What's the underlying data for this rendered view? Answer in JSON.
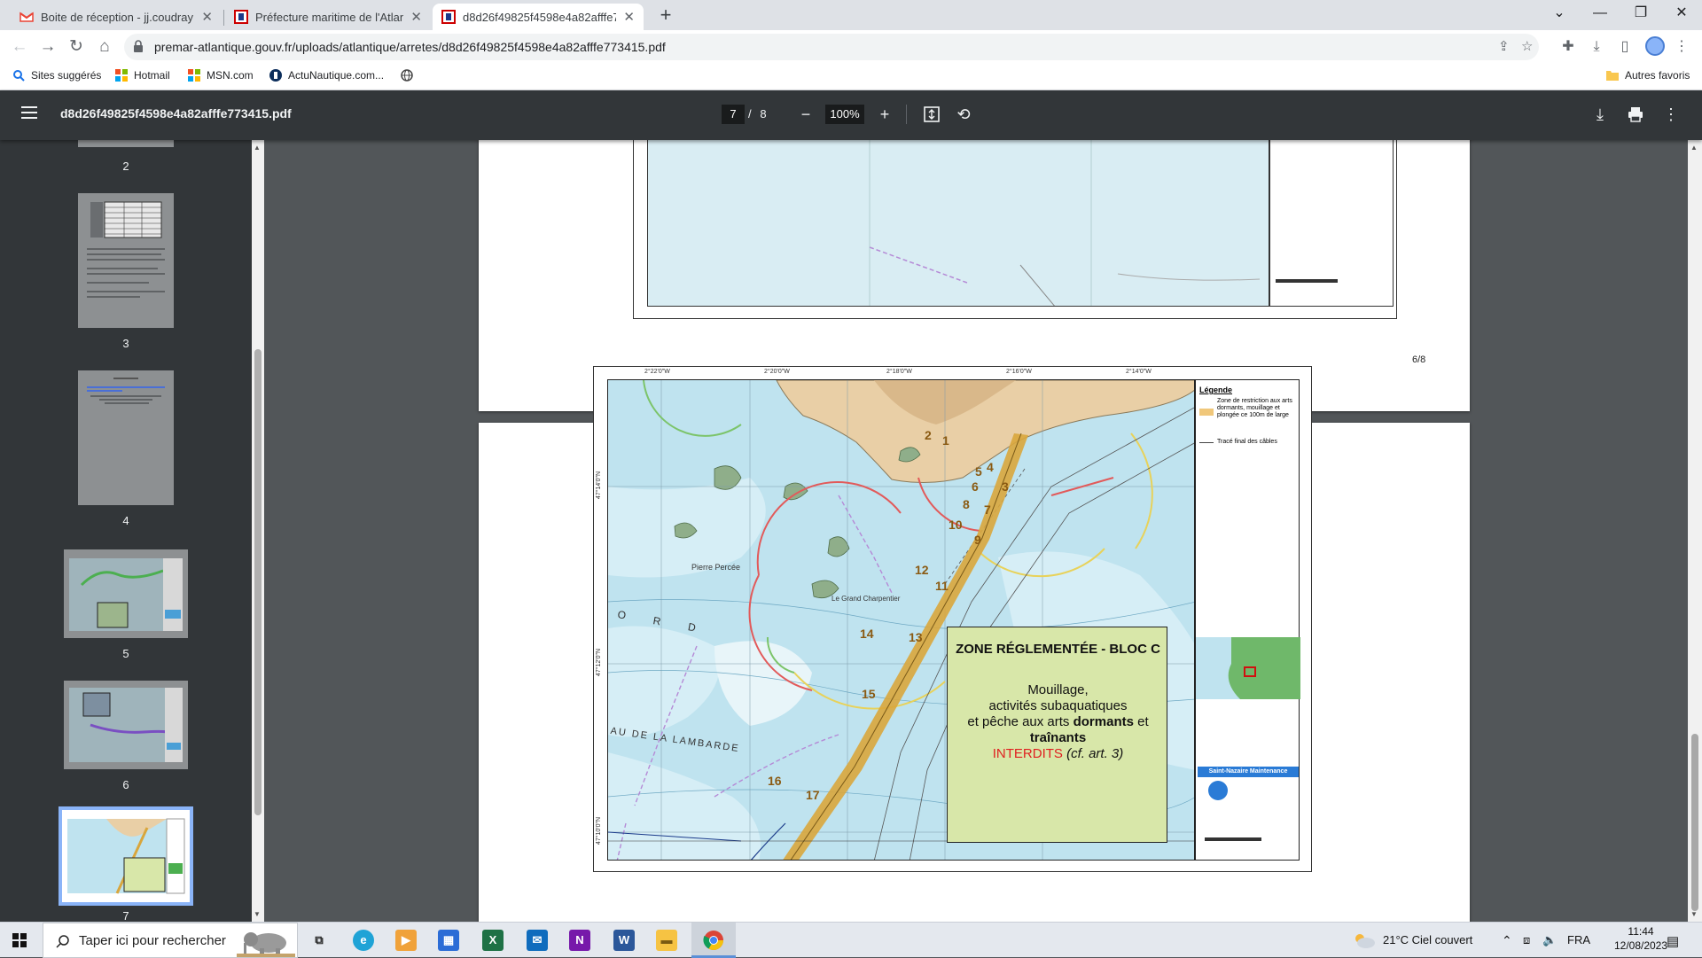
{
  "tabs": [
    {
      "title": "Boite de réception - jj.coudray@",
      "icon": "gmail-icon"
    },
    {
      "title": "Préfecture maritime de l'Atlantiq",
      "icon": "premar-icon"
    },
    {
      "title": "d8d26f49825f4598e4a82afffe773",
      "icon": "pdf-icon"
    }
  ],
  "omnibox": {
    "url": "premar-atlantique.gouv.fr/uploads/atlantique/arretes/d8d26f49825f4598e4a82afffe773415.pdf"
  },
  "bookmarks": [
    {
      "label": "Sites suggérés",
      "icon": "search-icon"
    },
    {
      "label": "Hotmail",
      "icon": "microsoft-icon"
    },
    {
      "label": "MSN.com",
      "icon": "microsoft-icon"
    },
    {
      "label": "ActuNautique.com...",
      "icon": "actunautique-icon"
    },
    {
      "label": "",
      "icon": "globe-icon"
    }
  ],
  "bookmarks_right": {
    "label": "Autres favoris",
    "icon": "folder-icon"
  },
  "pdf": {
    "filename": "d8d26f49825f4598e4a82afffe773415.pdf",
    "current_page": "7",
    "separator": "/",
    "total_pages": "8",
    "zoom": "100%",
    "page_footer": "6/8"
  },
  "thumbnails": [
    {
      "num": "2"
    },
    {
      "num": "3"
    },
    {
      "num": "4"
    },
    {
      "num": "5"
    },
    {
      "num": "6"
    },
    {
      "num": "7"
    }
  ],
  "map": {
    "lon_labels": [
      "2°22'0\"W",
      "2°20'0\"W",
      "2°18'0\"W",
      "2°16'0\"W",
      "2°14'0\"W"
    ],
    "lat_labels": [
      "47°14'0\"N",
      "47°12'0\"N",
      "47°10'0\"N"
    ],
    "point_numbers": [
      "1",
      "2",
      "3",
      "4",
      "5",
      "6",
      "7",
      "8",
      "9",
      "10",
      "11",
      "12",
      "13",
      "14",
      "15",
      "16",
      "17"
    ],
    "place_labels": [
      "Pierre Percée",
      "Le Grand Charpentier",
      "AU DE LA LAMBARDE",
      "O R D"
    ],
    "legend_title": "Légende",
    "legend_zone": "Zone de restriction aux arts dormants, mouillage et plongée ce 100m de large",
    "legend_line": "Tracé final des câbles",
    "legend_banner": "Saint-Nazaire Maintenance",
    "zone_title": "ZONE RÉGLEMENTÉE - BLOC C",
    "zone_line1": "Mouillage,",
    "zone_line2": "activités subaquatiques",
    "zone_line3a": "et pêche aux arts",
    "zone_line3b": "dormants",
    "zone_line3c": "et",
    "zone_line4": "traînants",
    "zone_forbidden": "INTERDITS",
    "zone_ref": "(cf. art. 3)"
  },
  "taskbar": {
    "search_placeholder": "Taper ici pour rechercher",
    "weather": "21°C  Ciel couvert",
    "lang": "FRA",
    "time": "11:44",
    "date": "12/08/2023"
  }
}
